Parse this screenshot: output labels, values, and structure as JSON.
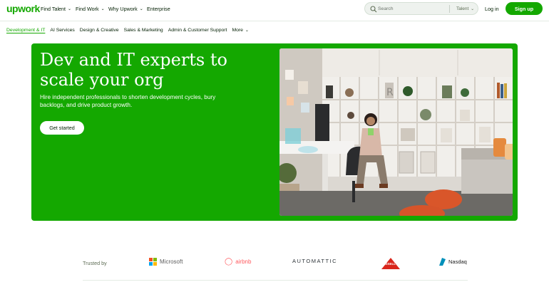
{
  "header": {
    "logo": "upwork",
    "nav": [
      {
        "label": "Find Talent",
        "dropdown": true
      },
      {
        "label": "Find Work",
        "dropdown": true
      },
      {
        "label": "Why Upwork",
        "dropdown": true
      },
      {
        "label": "Enterprise",
        "dropdown": false
      }
    ],
    "search": {
      "placeholder": "Search",
      "scope": "Talent"
    },
    "login_label": "Log in",
    "signup_label": "Sign up"
  },
  "categories": [
    {
      "label": "Development & IT",
      "active": true
    },
    {
      "label": "AI Services",
      "active": false
    },
    {
      "label": "Design & Creative",
      "active": false
    },
    {
      "label": "Sales & Marketing",
      "active": false
    },
    {
      "label": "Admin & Customer Support",
      "active": false
    },
    {
      "label": "More",
      "active": false
    }
  ],
  "hero": {
    "headline": "Dev and IT experts to scale your org",
    "subtext": "Hire independent professionals to shorten development cycles, bury backlogs, and drive product growth.",
    "cta_label": "Get started"
  },
  "trusted": {
    "label": "Trusted by",
    "logos": [
      {
        "name": "Microsoft"
      },
      {
        "name": "airbnb"
      },
      {
        "name": "AUTOMATTIC"
      },
      {
        "name": "BISSELL"
      },
      {
        "name": "Nasdaq"
      }
    ]
  },
  "colors": {
    "brand": "#14a800",
    "text": "#001e00"
  }
}
